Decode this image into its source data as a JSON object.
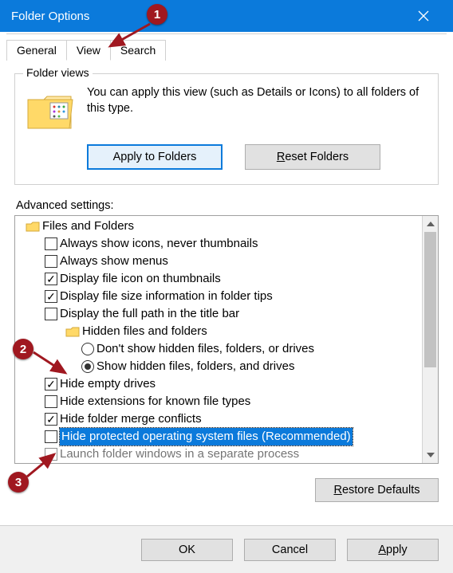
{
  "window": {
    "title": "Folder Options"
  },
  "tabs": {
    "general": "General",
    "view": "View",
    "search": "Search",
    "active": "view"
  },
  "folder_views": {
    "legend": "Folder views",
    "description": "You can apply this view (such as Details or Icons) to all folders of this type.",
    "apply_btn": "Apply to Folders",
    "reset_btn": "Reset Folders"
  },
  "advanced": {
    "label": "Advanced settings:",
    "root": "Files and Folders",
    "hidden_group": "Hidden files and folders",
    "items": {
      "always_icons": "Always show icons, never thumbnails",
      "always_menus": "Always show menus",
      "file_icon_thumb": "Display file icon on thumbnails",
      "file_size_tips": "Display file size information in folder tips",
      "full_path_title": "Display the full path in the title bar",
      "hidden_dont_show": "Don't show hidden files, folders, or drives",
      "hidden_show": "Show hidden files, folders, and drives",
      "hide_empty": "Hide empty drives",
      "hide_ext": "Hide extensions for known file types",
      "hide_merge": "Hide folder merge conflicts",
      "hide_protected": "Hide protected operating system files (Recommended)",
      "launch_sep": "Launch folder windows in a separate process"
    },
    "checked": {
      "file_icon_thumb": true,
      "file_size_tips": true,
      "hide_empty": true,
      "hide_merge": true
    },
    "radio_selected": "hidden_show"
  },
  "footer": {
    "restore": "Restore Defaults"
  },
  "buttons": {
    "ok": "OK",
    "cancel": "Cancel",
    "apply": "Apply"
  },
  "annotations": {
    "b1": "1",
    "b2": "2",
    "b3": "3"
  }
}
